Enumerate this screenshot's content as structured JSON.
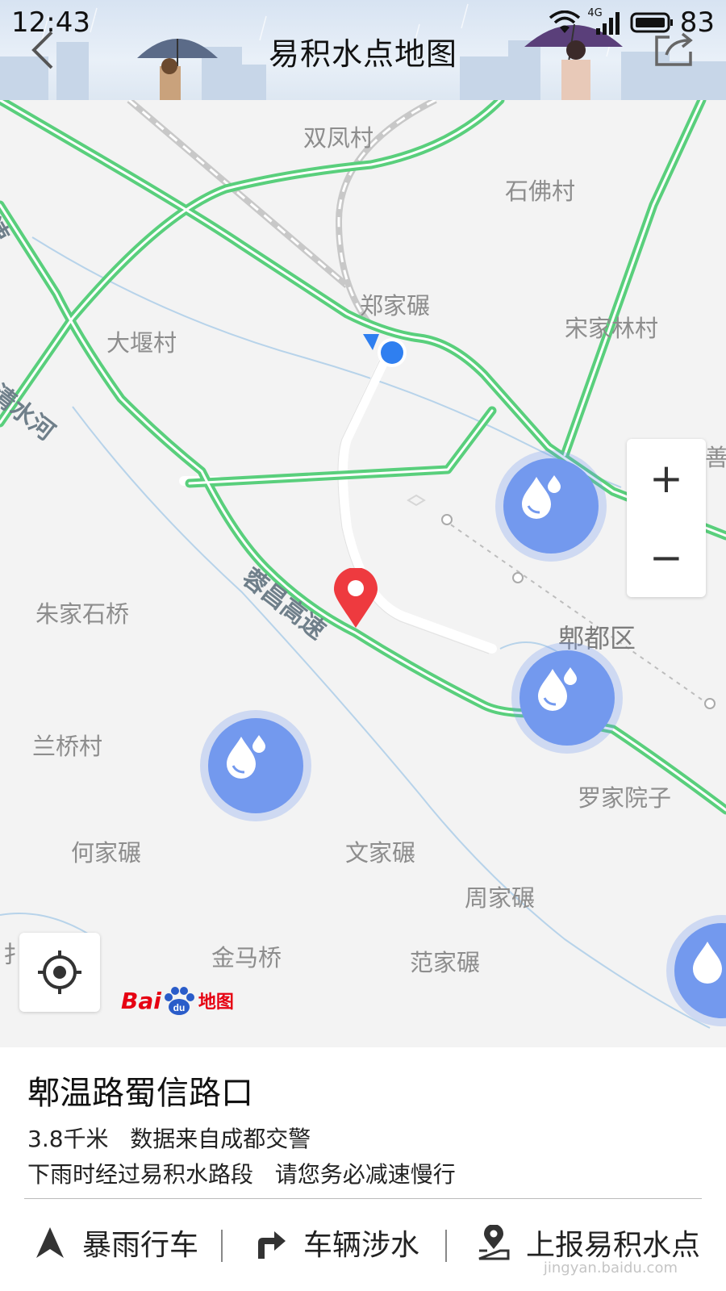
{
  "status_bar": {
    "time": "12:43",
    "network": "4G",
    "battery": "83"
  },
  "header": {
    "title": "易积水点地图"
  },
  "map": {
    "places": [
      {
        "id": "shuangfeng",
        "name": "双凤村"
      },
      {
        "id": "shifo",
        "name": "石佛村"
      },
      {
        "id": "zhengjiawo",
        "name": "郑家碾"
      },
      {
        "id": "songjialin",
        "name": "宋家林村"
      },
      {
        "id": "dayan",
        "name": "大堰村"
      },
      {
        "id": "zhujiashiqiao",
        "name": "朱家石桥"
      },
      {
        "id": "pidu",
        "name": "郫都区"
      },
      {
        "id": "lanqiao",
        "name": "兰桥村"
      },
      {
        "id": "luojiayuanzi",
        "name": "罗家院子"
      },
      {
        "id": "hejiawo",
        "name": "何家碾"
      },
      {
        "id": "wenjiawo",
        "name": "文家碾"
      },
      {
        "id": "zhoujiawo",
        "name": "周家碾"
      },
      {
        "id": "jinmaqiao",
        "name": "金马桥"
      },
      {
        "id": "fanjiawo",
        "name": "范家碾"
      },
      {
        "id": "shan_partial",
        "name": "善"
      },
      {
        "id": "left_partial",
        "name": "扌"
      }
    ],
    "road_labels": [
      {
        "id": "qingshuihe",
        "name": "清水河"
      },
      {
        "id": "rongchang",
        "name": "蓉昌高速"
      },
      {
        "id": "left_edge",
        "name": "快速"
      }
    ],
    "zoom_in": "+",
    "zoom_out": "−",
    "logo": {
      "bai": "Bai",
      "du": "du",
      "map": "地图"
    }
  },
  "info": {
    "title": "郫温路蜀信路口",
    "distance": "3.8千米",
    "source": "数据来自成都交警",
    "tip_1": "下雨时经过易积水路段",
    "tip_2": "请您务必减速慢行"
  },
  "actions": [
    {
      "id": "storm-driving",
      "label": "暴雨行车",
      "icon": "navigation-arrow-icon"
    },
    {
      "id": "vehicle-wading",
      "label": "车辆涉水",
      "icon": "turn-right-arrow-icon"
    },
    {
      "id": "report-point",
      "label": "上报易积水点",
      "icon": "location-pin-icon"
    }
  ],
  "watermark": "jingyan.baidu.com",
  "colors": {
    "road": "#59cf7c",
    "marker": "#7399ee",
    "pin": "#ee3a3f",
    "location": "#2f7ff0"
  }
}
